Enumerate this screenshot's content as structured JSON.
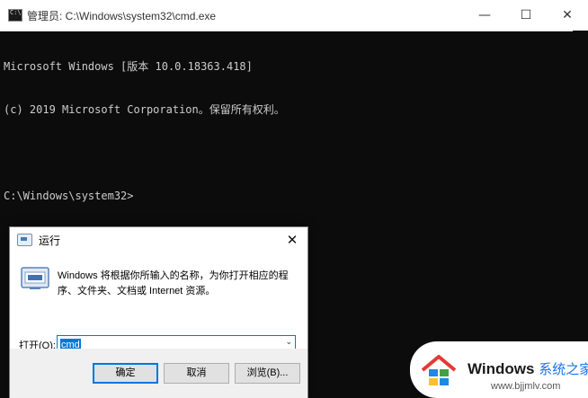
{
  "cmd": {
    "title": "管理员: C:\\Windows\\system32\\cmd.exe",
    "lines": [
      "Microsoft Windows [版本 10.0.18363.418]",
      "(c) 2019 Microsoft Corporation。保留所有权利。",
      "",
      "C:\\Windows\\system32>"
    ],
    "controls": {
      "minimize": "—",
      "maximize": "☐",
      "close": "✕"
    }
  },
  "run": {
    "title": "运行",
    "close": "✕",
    "description": "Windows 将根据你所输入的名称，为你打开相应的程序、文件夹、文档或 Internet 资源。",
    "open_label": "打开(O):",
    "open_value": "cmd",
    "buttons": {
      "ok": "确定",
      "cancel": "取消",
      "browse": "浏览(B)..."
    }
  },
  "watermark": {
    "brand": "Windows",
    "brand_accent": "系统之家",
    "url": "www.bjjmlv.com"
  },
  "colors": {
    "cmd_bg": "#0c0c0c",
    "cmd_text": "#cccccc",
    "selection": "#0078d7",
    "desktop": "#1976d2"
  }
}
